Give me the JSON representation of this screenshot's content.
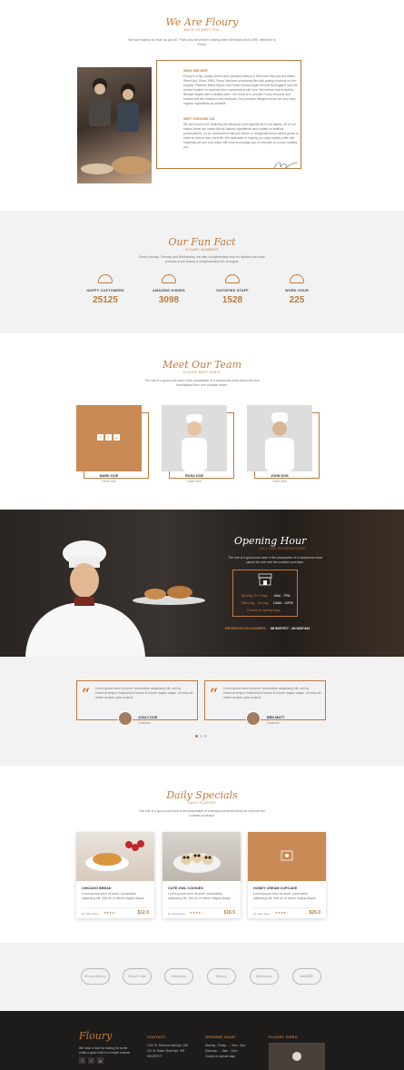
{
  "about": {
    "title": "We Are Floury",
    "subtitle": "BACK TO MEET YOU",
    "intro": "We have bakery as much as you do. That's why we've been helping them fill fellows since 1995. Welcome to Floury.",
    "who_heading": "WHO WE ARE",
    "who_text": "Floury is a big, locally owned and operated bakery in Sherman Mall Apt and Baker Street Apt. Since 1995, Floury has been producing the high quality products on the popular. Partners Mena Mauer and Robert McAlmongle felt that Burlingame was the perfect location to continue their commitment with love. We believe that a healthy lifestyle begins with a healthy start. Our focus is to provide Floury desserts and snacks that are nutritious and delicious. Our products always feature our very best, organic ingredients as possible.",
    "why_heading": "WHY CHOOSE US",
    "why_text": "We are proud to be featuring the following local ingredients in our bakery. All of our bakery items are made with all natural ingredients and contain no artificial preservatives, so we recommend that you freeze or refrigerate these baked goods in order to extend their shelf life. We dedicated to helping you stay healthy while still. Hopefully we can now share with help encourage you on the path to a more healthy you."
  },
  "fun": {
    "title": "Our Fun Fact",
    "subtitle": "FLOURY NUMBERS",
    "intro": "Every Monday, Tuesday and Wednesday, we offer complimentary food for families that order products in our bakery a complimentary box of bagels.",
    "stats": [
      {
        "label": "HAPPY CUSTOMERS",
        "value": "25125"
      },
      {
        "label": "AMAZING DISHES",
        "value": "3098"
      },
      {
        "label": "SATISFIED STAFF",
        "value": "1528"
      },
      {
        "label": "WORK HOUR",
        "value": "225"
      }
    ]
  },
  "team": {
    "title": "Meet Our Team",
    "subtitle": "FLOURY BEST USELY",
    "intro": "The role of a good cook ware in the preparation of a sumptuous meal cannot be over emphasized then one consider stirrer.",
    "members": [
      {
        "name": "MARK DOE",
        "role": "Head Chef"
      },
      {
        "name": "ROSA DOE",
        "role": "Head Chef"
      },
      {
        "name": "JOHN DOE",
        "role": "Head Chef"
      }
    ]
  },
  "opening": {
    "title": "Opening Hour",
    "subtitle": "CALL FOR RESERVATIONS",
    "desc": "The role of a good cook ware in the preparation of a sumptuous meal cannot be over see the consider purchase.",
    "weekday_label": "Monday To Friday",
    "weekday_hours": "9AM - 7PM",
    "weekend_label": "Saturday - Sunday",
    "weekend_hours": "10AM - 10PM",
    "special": "Closed on special days",
    "reservation_label": "RESERVATION NUMBER:",
    "reservation_number": "08 5297077 - 08 5297422"
  },
  "testimonials": [
    {
      "text": "Lorem ipsum dolor sit amet, consectetur adipisicing elit, sed do eiusmod tempor incididunt ut labore et dolore magna aliqua. Ut enim ad minim veniam, quis nostrud.",
      "name": "JOSLY DOE",
      "role": "Customer"
    },
    {
      "text": "Lorem ipsum dolor sit amet, consectetur adipisicing elit, sed do eiusmod tempor incididunt ut labore et dolore magna aliqua. Ut enim ad minim veniam, quis nostrud.",
      "name": "BEN MATT",
      "role": "Customer"
    }
  ],
  "specials": {
    "title": "Daily Specials",
    "subtitle": "DAILY FLAVORS",
    "intro": "The role of a good cook ware in the preparation of a sumptuous meal cannot be over see the consider purchase.",
    "items": [
      {
        "name": "CHICAGO BREAD",
        "desc": "Lorem ipsum dolor sit amet, consectetur adipiscing elit. Sed do ut dolore magna aliqua.",
        "by": "By Jakie Bays",
        "stars": "★★★★☆",
        "price": "$12.0"
      },
      {
        "name": "CUTE OWL COOKIES",
        "desc": "Lorem ipsum dolor sit amet, consectetur adipiscing elit. Sed do ut dolore magna aliqua.",
        "by": "By Jakie Bays",
        "stars": "★★★★☆",
        "price": "$18.5"
      },
      {
        "name": "HONEY CREAM CUPCAKE",
        "desc": "Lorem ipsum dolor sit amet, consectetur adipiscing elit. Sed do ut dolore magna aliqua.",
        "by": "By Jakie Bays",
        "stars": "★★★★☆",
        "price": "$25.0"
      }
    ]
  },
  "brands": [
    "Floury Bakery",
    "Bread Cake",
    "Patisserie",
    "Bakery",
    "Bakehouse",
    "BAKERY"
  ],
  "footer": {
    "logo": "Floury",
    "about": "We have a love for baking for some really a good craft in a simple manner.",
    "contact_heading": "CONTACT",
    "contact_lines": [
      "1212 St. Sherman Mall Apt. 355",
      "121 St. Baker Street Apt. 999",
      "08 5297077"
    ],
    "hours_heading": "OPENING HOUR",
    "hours_lines": [
      "Monday - Friday ..... 9am - 9pm",
      "Saturday ..... 8am - 11pm",
      "Closed on special days"
    ],
    "video_heading": "FLOURY VIDEO"
  },
  "colors": {
    "accent": "#c07a3c",
    "dark": "#1e1c1b",
    "light": "#f2f2f2"
  }
}
